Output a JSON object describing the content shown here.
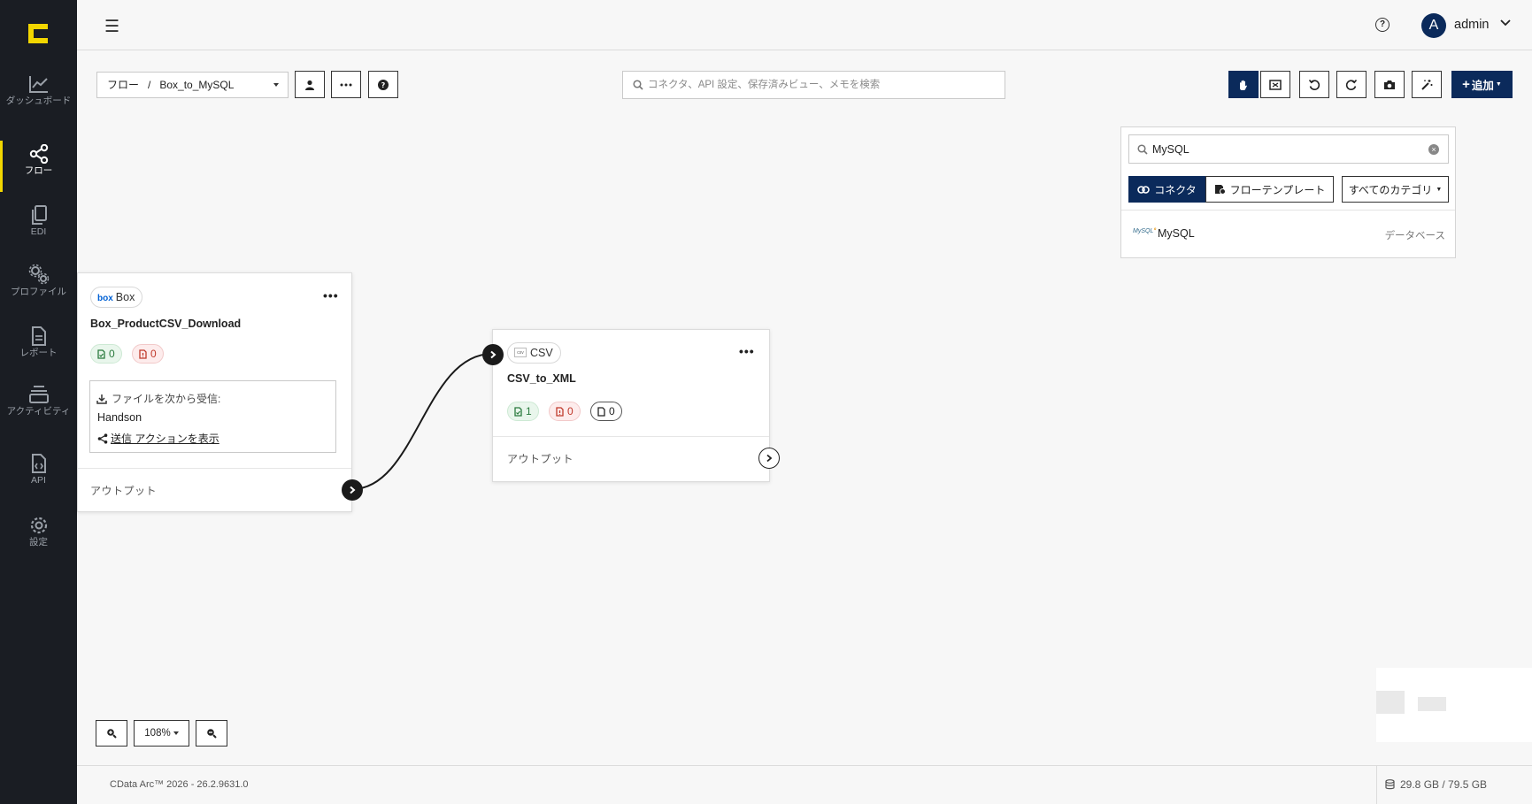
{
  "sidebar": {
    "logo_icon": "cdata-logo-icon",
    "items": [
      {
        "label": "ダッシュボード",
        "icon": "chart-line-icon",
        "active": false
      },
      {
        "label": "フロー",
        "icon": "share-nodes-icon",
        "active": true
      },
      {
        "label": "EDI",
        "icon": "documents-icon",
        "active": false
      },
      {
        "label": "プロファイル",
        "icon": "gears-icon",
        "active": false
      },
      {
        "label": "レポート",
        "icon": "report-icon",
        "active": false
      },
      {
        "label": "アクティビティ",
        "icon": "stack-icon",
        "active": false
      },
      {
        "label": "API",
        "icon": "api-file-icon",
        "active": false
      },
      {
        "label": "設定",
        "icon": "gear-icon",
        "active": false
      }
    ]
  },
  "header": {
    "user_initial": "A",
    "user_name": "admin"
  },
  "toolbar": {
    "breadcrumb_root": "フロー",
    "breadcrumb_sep": "/",
    "breadcrumb_current": "Box_to_MySQL",
    "search_placeholder": "コネクタ、API 設定、保存済みビュー、メモを検索",
    "add_label": "追加"
  },
  "connector_panel": {
    "search_value": "MySQL",
    "tab_connectors": "コネクタ",
    "tab_templates": "フローテンプレート",
    "category_select": "すべてのカテゴリ",
    "results": [
      {
        "logo_text": "MySQL",
        "name": "MySQL",
        "category": "データベース"
      }
    ]
  },
  "nodes": {
    "box": {
      "badge": "Box",
      "badge_logo": "box",
      "title": "Box_ProductCSV_Download",
      "success_count": "0",
      "error_count": "0",
      "receive_label": "ファイルを次から受信:",
      "receive_value": "Handson",
      "send_link": "送信 アクションを表示",
      "output_label": "アウトプット"
    },
    "csv": {
      "badge": "CSV",
      "badge_logo": "csv",
      "title": "CSV_to_XML",
      "success_count": "1",
      "error_count": "0",
      "queue_count": "0",
      "output_label": "アウトプット"
    }
  },
  "zoom": {
    "level": "108%"
  },
  "footer": {
    "version": "CData Arc™ 2026 - 26.2.9631.0",
    "storage": "29.8 GB / 79.5 GB"
  },
  "colors": {
    "sidebar_bg": "#1a1d23",
    "accent_yellow": "#f2d600",
    "primary_navy": "#0b2a5b"
  }
}
